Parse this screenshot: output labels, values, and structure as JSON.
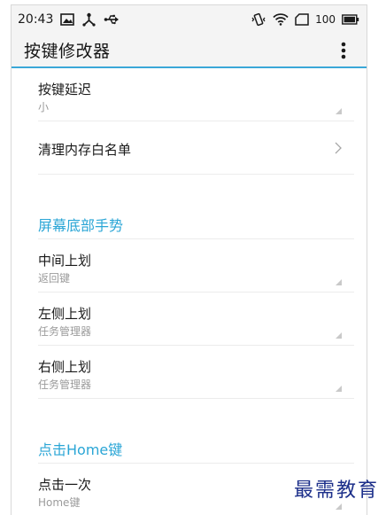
{
  "status_bar": {
    "time": "20:43",
    "battery_level": "100",
    "icons_left": [
      "image-icon",
      "usb-share-icon",
      "usb-icon"
    ],
    "icons_right": [
      "vibrate-icon",
      "wifi-icon",
      "signal-frame-icon",
      "battery-icon"
    ]
  },
  "app_bar": {
    "title": "按键修改器",
    "menu_icon": "more-vertical-icon"
  },
  "prefs": {
    "key_delay": {
      "title": "按键延迟",
      "summary": "小"
    },
    "memory_whitelist": {
      "title": "清理内存白名单"
    }
  },
  "sections": {
    "bottom_gesture": {
      "header": "屏幕底部手势",
      "items": [
        {
          "title": "中间上划",
          "summary": "返回键"
        },
        {
          "title": "左侧上划",
          "summary": "任务管理器"
        },
        {
          "title": "右侧上划",
          "summary": "任务管理器"
        }
      ]
    },
    "home_click": {
      "header": "点击Home键",
      "items": [
        {
          "title": "点击一次",
          "summary": "Home键"
        }
      ]
    }
  },
  "watermark": "最需教育",
  "colors": {
    "accent": "#2ba6d6",
    "divider": "#ececec",
    "summary": "#9b9b9b",
    "watermark": "#1c2f8a"
  }
}
